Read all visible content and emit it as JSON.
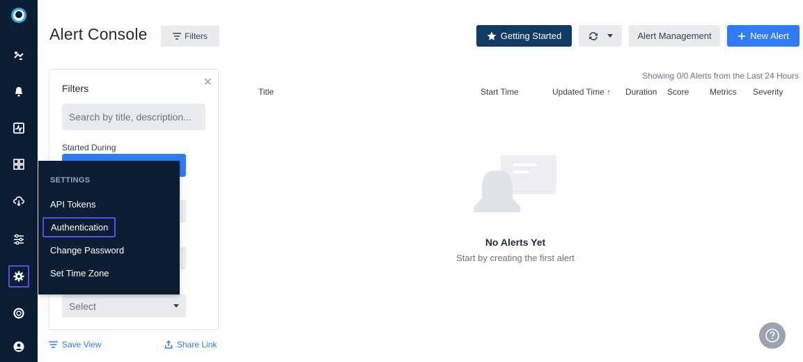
{
  "header": {
    "title": "Alert Console",
    "filters_label": "Filters",
    "getting_started_label": "Getting Started",
    "alert_management_label": "Alert Management",
    "new_alert_label": "New Alert"
  },
  "filters_panel": {
    "title": "Filters",
    "search_placeholder": "Search by title, description...",
    "started_during_label": "Started During",
    "select_value": "Select",
    "save_view_label": "Save View",
    "share_link_label": "Share Link"
  },
  "table": {
    "summary": "Showing 0/0 Alerts from the Last 24 Hours",
    "columns": {
      "title": "Title",
      "start_time": "Start Time",
      "updated_time": "Updated Time",
      "duration": "Duration",
      "score": "Score",
      "metrics": "Metrics",
      "severity": "Severity"
    },
    "sort_indicator": "↑"
  },
  "empty_state": {
    "title": "No Alerts Yet",
    "subtitle": "Start by creating the first alert"
  },
  "settings_menu": {
    "header": "SETTINGS",
    "items": [
      {
        "label": "API Tokens"
      },
      {
        "label": "Authentication"
      },
      {
        "label": "Change Password"
      },
      {
        "label": "Set Time Zone"
      }
    ]
  },
  "nav": {
    "items": [
      {
        "icon": "logo-icon"
      },
      {
        "icon": "integrations-icon"
      },
      {
        "icon": "alerts-bell-icon"
      },
      {
        "icon": "metrics-chart-icon"
      },
      {
        "icon": "dashboards-icon"
      },
      {
        "icon": "cloud-icon"
      },
      {
        "icon": "sliders-icon"
      },
      {
        "icon": "gear-icon"
      },
      {
        "icon": "help-ring-icon"
      },
      {
        "icon": "user-icon"
      }
    ]
  },
  "colors": {
    "rail_bg": "#0b1d33",
    "primary": "#2f7cf6",
    "getting_started_bg": "#123a63",
    "highlight_border": "#5b4ee8"
  }
}
